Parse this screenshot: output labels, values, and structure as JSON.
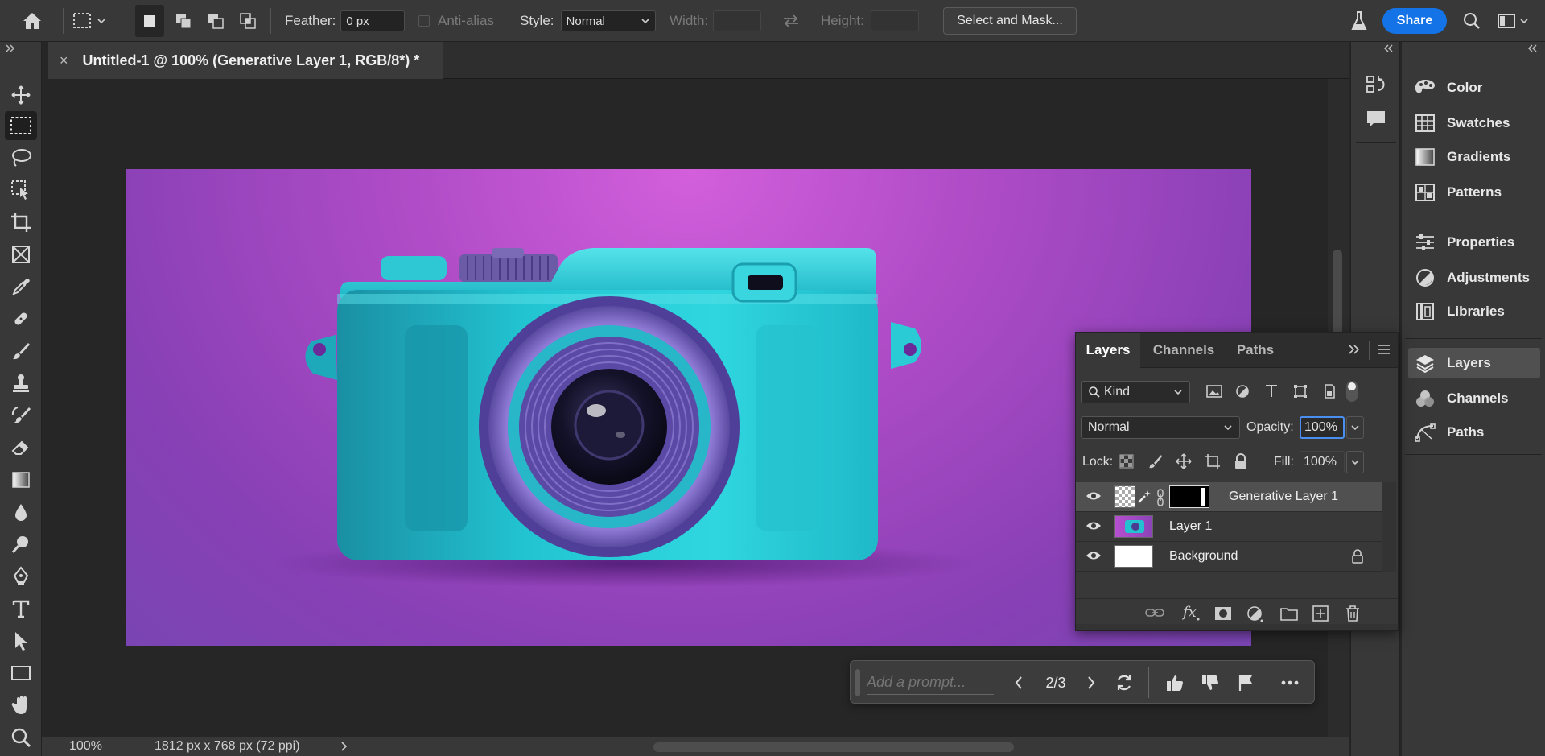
{
  "options_bar": {
    "feather_label": "Feather:",
    "feather_value": "0 px",
    "antialias_label": "Anti-alias",
    "style_label": "Style:",
    "style_value": "Normal",
    "width_label": "Width:",
    "height_label": "Height:",
    "select_mask_label": "Select and Mask...",
    "share_label": "Share"
  },
  "document": {
    "tab_title": "Untitled-1 @ 100% (Generative Layer 1, RGB/8*) *"
  },
  "status": {
    "zoom": "100%",
    "doc_info": "1812 px x 768 px (72 ppi)"
  },
  "right_panels": {
    "items": [
      {
        "label": "Color",
        "icon": "palette-icon"
      },
      {
        "label": "Swatches",
        "icon": "grid-icon"
      },
      {
        "label": "Gradients",
        "icon": "gradient-icon"
      },
      {
        "label": "Patterns",
        "icon": "pattern-icon"
      },
      {
        "label": "Properties",
        "icon": "sliders-icon"
      },
      {
        "label": "Adjustments",
        "icon": "half-circle-icon"
      },
      {
        "label": "Libraries",
        "icon": "library-icon"
      },
      {
        "label": "Layers",
        "icon": "layers-icon"
      },
      {
        "label": "Channels",
        "icon": "channels-icon"
      },
      {
        "label": "Paths",
        "icon": "pen-path-icon"
      }
    ]
  },
  "layers_panel": {
    "tabs": [
      "Layers",
      "Channels",
      "Paths"
    ],
    "filter_value": "Kind",
    "blend_mode": "Normal",
    "opacity_label": "Opacity:",
    "opacity_value": "100%",
    "lock_label": "Lock:",
    "fill_label": "Fill:",
    "fill_value": "100%",
    "layers": [
      {
        "name": "Generative Layer 1",
        "selected": true
      },
      {
        "name": "Layer 1",
        "selected": false
      },
      {
        "name": "Background",
        "selected": false,
        "locked": true
      }
    ]
  },
  "prompt_bar": {
    "placeholder": "Add a prompt...",
    "counter": "2/3"
  },
  "colors": {
    "accent": "#1473e6",
    "panel_bg": "#383838",
    "canvas_bg": "#262626",
    "camera_teal": "#1fc7d3",
    "background_purple": "#b04cc7"
  }
}
